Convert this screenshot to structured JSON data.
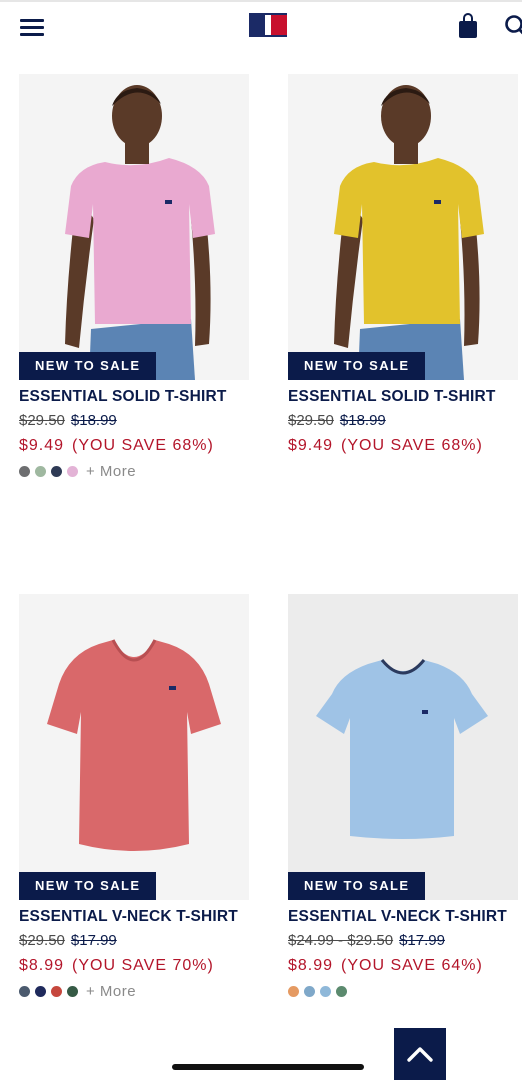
{
  "header": {
    "logo": "tommy-flag-logo",
    "menu_icon": "hamburger-menu-icon",
    "bag_icon": "shopping-bag-icon",
    "search_icon": "search-icon"
  },
  "colors": {
    "navy": "#0b1b4a",
    "sale_red": "#b3152a",
    "image_bg": "#f4f4f4"
  },
  "products": [
    {
      "badge": "NEW TO SALE",
      "name": "ESSENTIAL SOLID T-SHIRT",
      "original_price": "$29.50",
      "previous_price": "$18.99",
      "sale_price": "$9.49",
      "savings": "(YOU SAVE 68%)",
      "swatches": [
        "#6d6e70",
        "#9fb8a0",
        "#2e3a55",
        "#e3b3d6"
      ],
      "more": "+ More",
      "shirt_color": "#e9a9d0"
    },
    {
      "badge": "NEW TO SALE",
      "name": "ESSENTIAL SOLID T-SHIRT",
      "original_price": "$29.50",
      "previous_price": "$18.99",
      "sale_price": "$9.49",
      "savings": "(YOU SAVE 68%)",
      "swatches": [],
      "more": "",
      "shirt_color": "#e2c22c"
    },
    {
      "badge": "NEW TO SALE",
      "name": "ESSENTIAL V-NECK T-SHIRT",
      "original_price": "$29.50",
      "previous_price": "$17.99",
      "sale_price": "$8.99",
      "savings": "(YOU SAVE 70%)",
      "swatches": [
        "#4b5a6e",
        "#1f2a5c",
        "#c6473d",
        "#355a45"
      ],
      "more": "+ More",
      "shirt_color": "#d9686a"
    },
    {
      "badge": "NEW TO SALE",
      "name": "ESSENTIAL V-NECK T-SHIRT",
      "original_price": "$24.99 - $29.50",
      "previous_price": "$17.99",
      "sale_price": "$8.99",
      "savings": "(YOU SAVE 64%)",
      "swatches": [
        "#e59a62",
        "#7fa8c9",
        "#8fb8d9",
        "#5b8a6e"
      ],
      "more": "",
      "shirt_color": "#9fc3e6"
    }
  ],
  "scroll_top_icon": "chevron-up-icon"
}
